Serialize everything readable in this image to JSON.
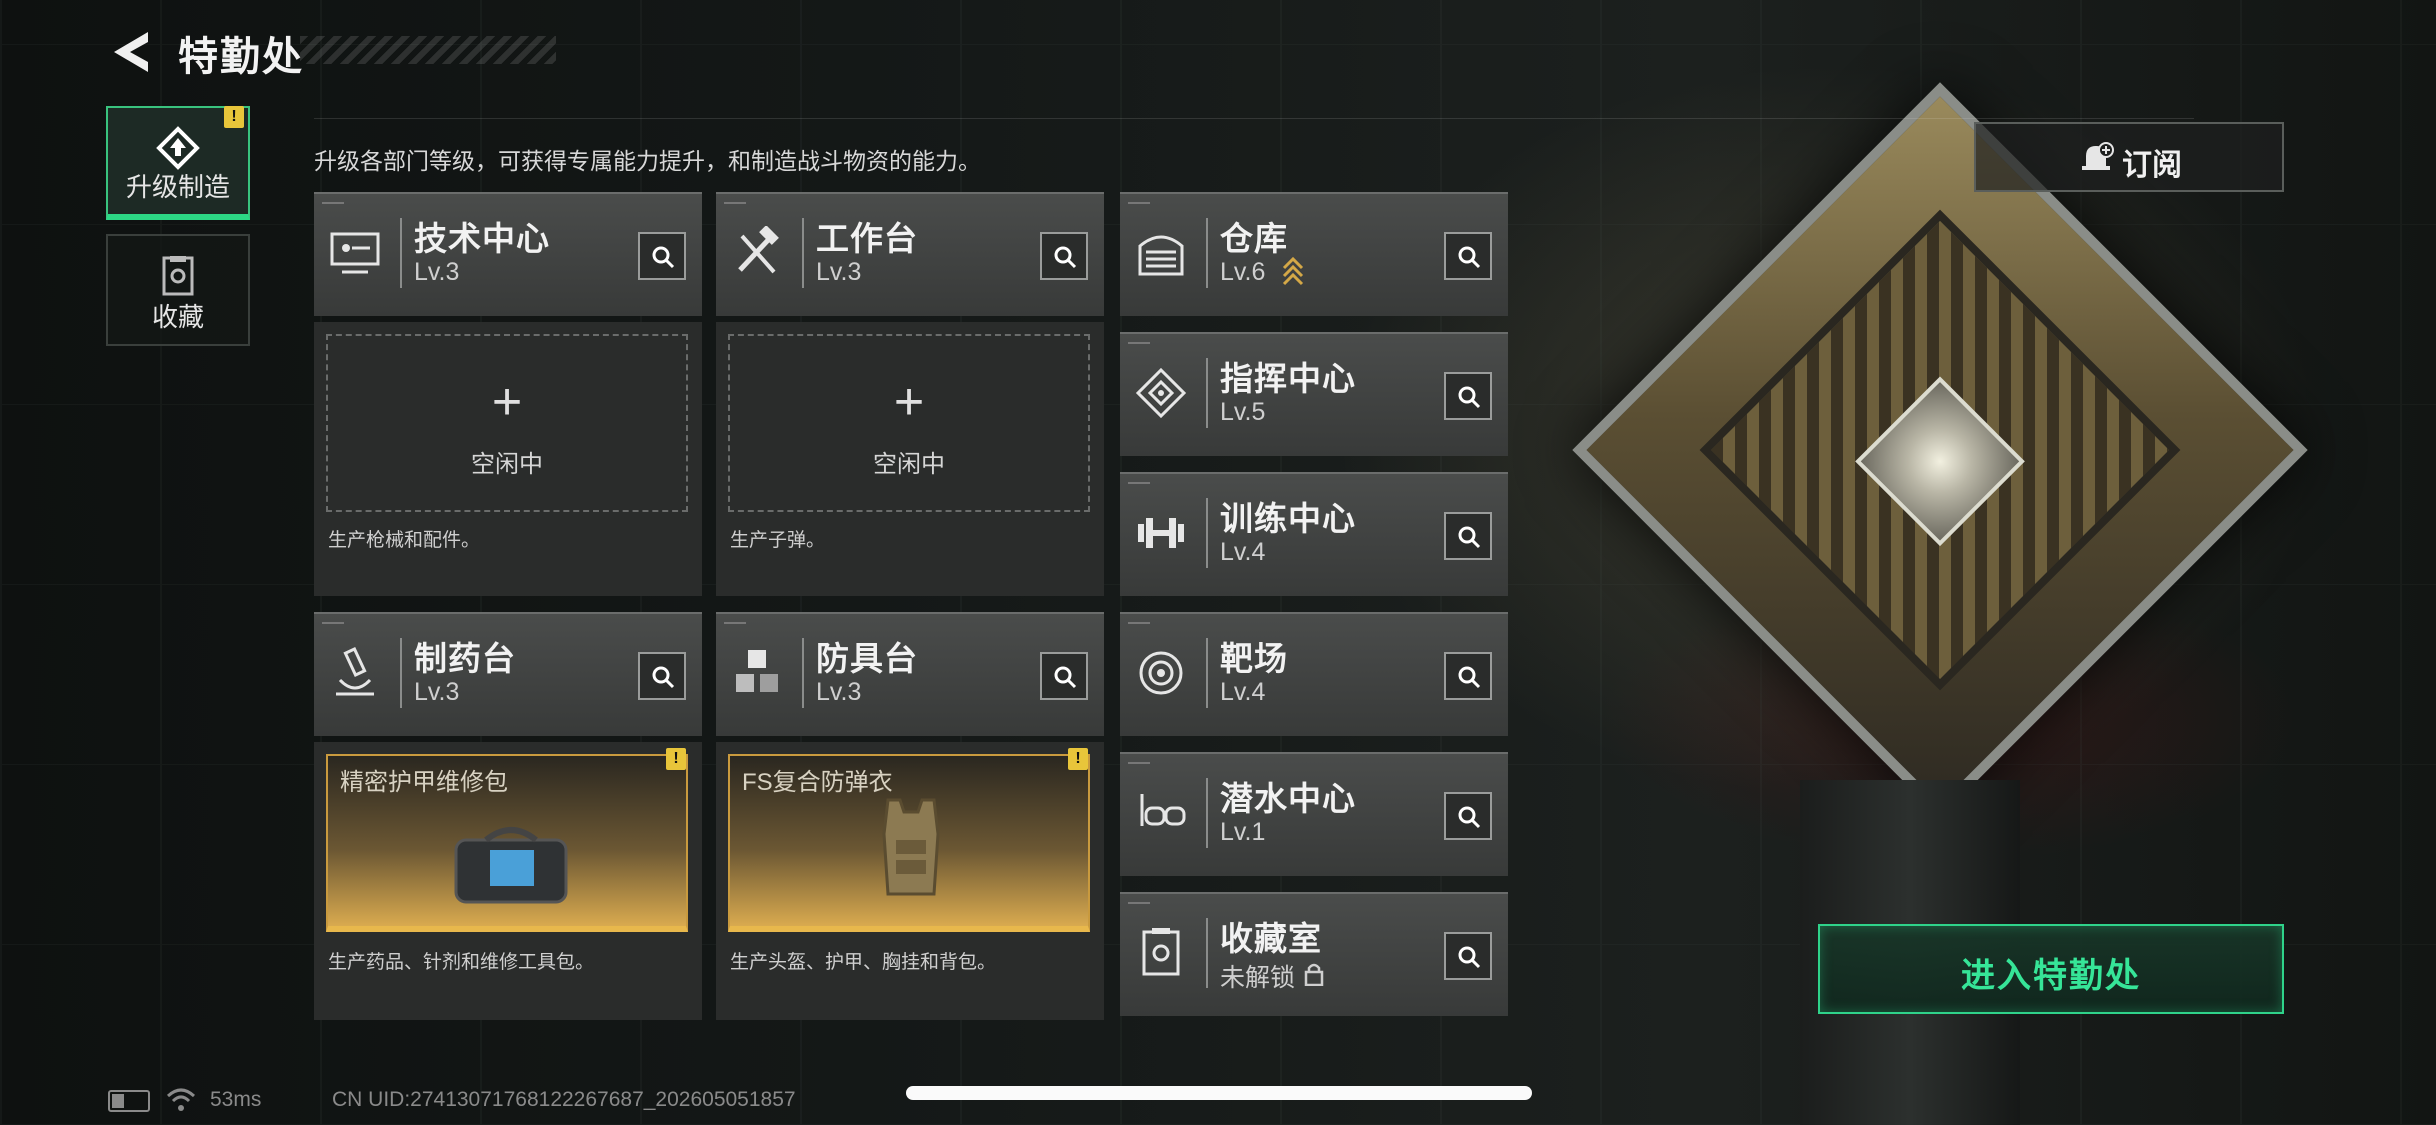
{
  "header": {
    "title": "特勤处"
  },
  "nav": {
    "items": [
      {
        "label": "升级制造",
        "active": true,
        "alert": "!"
      },
      {
        "label": "收藏",
        "active": false
      }
    ]
  },
  "description": "升级各部门等级，可获得专属能力提升，和制造战斗物资的能力。",
  "subscribe": {
    "label": "订阅",
    "icon": "bell-plus-icon"
  },
  "enter_button": {
    "label": "进入特勤处"
  },
  "departments": {
    "tech_center": {
      "name": "技术中心",
      "level": "Lv.3",
      "icon": "monitor-icon"
    },
    "workbench": {
      "name": "工作台",
      "level": "Lv.3",
      "icon": "hammer-wrench-icon"
    },
    "warehouse": {
      "name": "仓库",
      "level": "Lv.6",
      "icon": "shutter-icon",
      "upgradable": true
    },
    "command_center": {
      "name": "指挥中心",
      "level": "Lv.5",
      "icon": "command-emblem-icon"
    },
    "training_center": {
      "name": "训练中心",
      "level": "Lv.4",
      "icon": "dumbbell-icon"
    },
    "pharmacy": {
      "name": "制药台",
      "level": "Lv.3",
      "icon": "microscope-icon"
    },
    "armor_bench": {
      "name": "防具台",
      "level": "Lv.3",
      "icon": "cubes-icon"
    },
    "shooting_range": {
      "name": "靶场",
      "level": "Lv.4",
      "icon": "target-icon"
    },
    "diving_center": {
      "name": "潜水中心",
      "level": "Lv.1",
      "icon": "diving-mask-icon"
    },
    "collection_room": {
      "name": "收藏室",
      "level": "未解锁",
      "icon": "trophy-case-icon",
      "locked": true
    }
  },
  "production": {
    "tech_center": {
      "status": "空闲中",
      "desc": "生产枪械和配件。"
    },
    "workbench": {
      "status": "空闲中",
      "desc": "生产子弹。"
    },
    "pharmacy": {
      "item": "精密护甲维修包",
      "desc": "生产药品、针剂和维修工具包。",
      "alert": "!"
    },
    "armor_bench": {
      "item": "FS复合防弹衣",
      "desc": "生产头盔、护甲、胸挂和背包。",
      "alert": "!"
    }
  },
  "status_bar": {
    "ping": "53ms",
    "uid": "CN UID:27413071768122267687_202605051857"
  },
  "colors": {
    "accent_green": "#2fd38a",
    "item_gold": "#e8b84c",
    "alert_yellow": "#e8c53a"
  }
}
